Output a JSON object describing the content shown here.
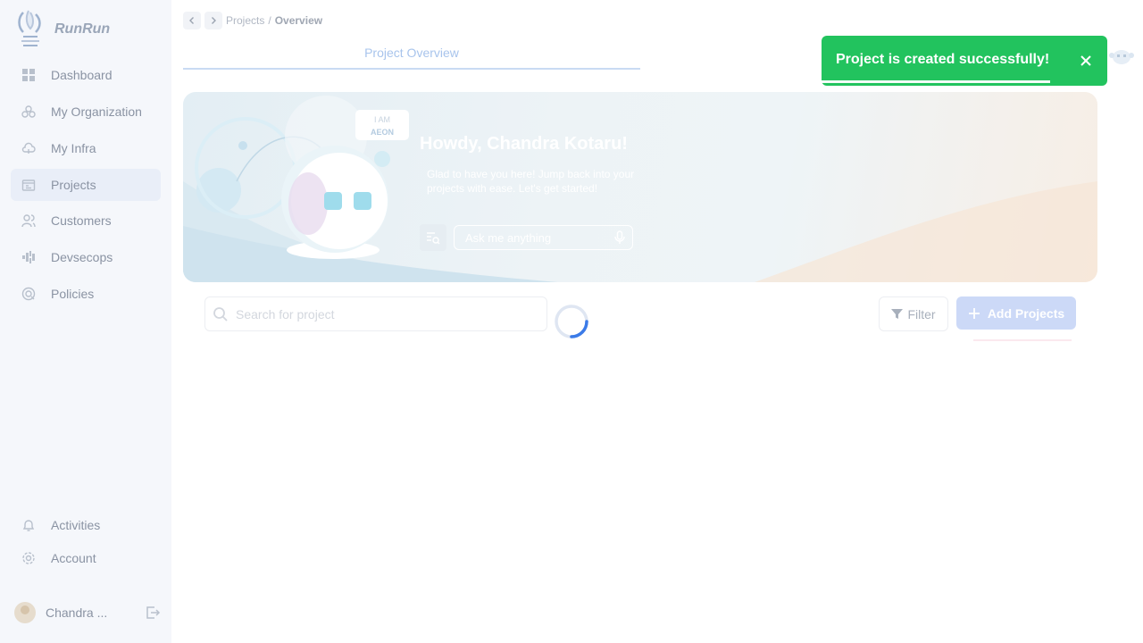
{
  "app": {
    "brand": "RunRun"
  },
  "sidebar": {
    "items": [
      {
        "label": "Dashboard",
        "icon": "dashboard-icon"
      },
      {
        "label": "My Organization",
        "icon": "organization-icon"
      },
      {
        "label": "My Infra",
        "icon": "cloud-icon"
      },
      {
        "label": "Projects",
        "icon": "projects-icon",
        "active": true
      },
      {
        "label": "Customers",
        "icon": "users-icon"
      },
      {
        "label": "Devsecops",
        "icon": "devsecops-icon"
      },
      {
        "label": "Policies",
        "icon": "policy-icon"
      }
    ],
    "bottom_items": [
      {
        "label": "Activities",
        "icon": "bell-icon"
      },
      {
        "label": "Account",
        "icon": "gear-icon"
      }
    ],
    "user": {
      "name": "Chandra ..."
    }
  },
  "breadcrumb": {
    "parent": "Projects",
    "separator": "/",
    "current": "Overview"
  },
  "tabs": [
    {
      "label": "Project Overview",
      "active": true
    }
  ],
  "banner": {
    "badge_line1": "I AM",
    "badge_line2": "AEON",
    "greeting": "Howdy, Chandra Kotaru!",
    "subtitle": "Glad to have you here! Jump back into your projects with ease. Let's get started!",
    "ask_placeholder": "Ask me anything"
  },
  "toolbar": {
    "search_placeholder": "Search for project",
    "filter_label": "Filter",
    "add_label": "Add Projects"
  },
  "toast": {
    "message": "Project is created successfully!",
    "progress": 0.8,
    "color": "#22c35e"
  },
  "colors": {
    "accent": "#3b7be8",
    "success": "#22c35e"
  }
}
